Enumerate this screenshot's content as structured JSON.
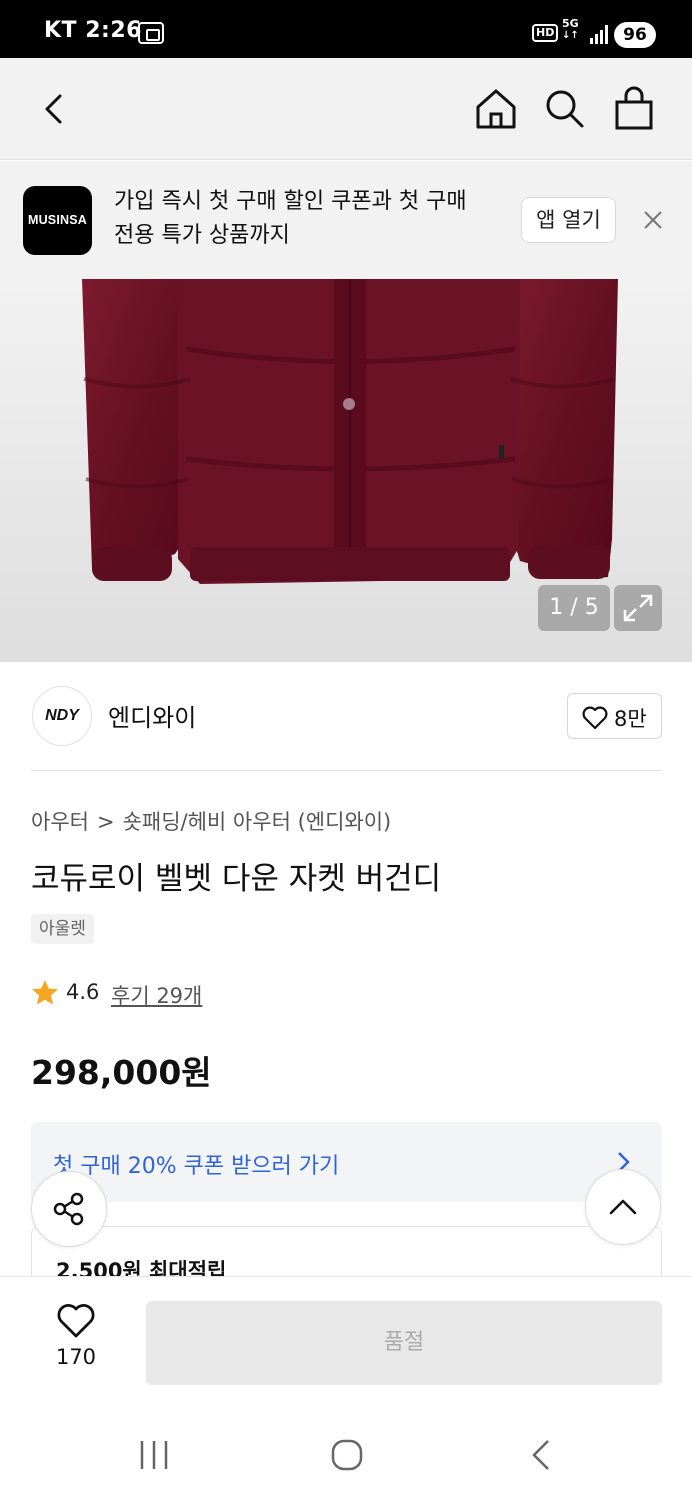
{
  "status_bar": {
    "carrier_time": "KT 2:26",
    "hd": "HD",
    "network": "5G",
    "battery": "96"
  },
  "banner": {
    "logo_text": "MUSINSA",
    "line1": "가입 즉시 첫 구매 할인 쿠폰과 첫 구매",
    "line2": "전용 특가 상품까지",
    "open_app_label": "앱 열기"
  },
  "gallery": {
    "counter": "1 / 5"
  },
  "brand": {
    "logo_text": "NDY",
    "name": "엔디와이",
    "likes": "8만"
  },
  "breadcrumb": {
    "category1": "아우터",
    "separator": ">",
    "category2": "숏패딩/헤비 아우터 (엔디와이)"
  },
  "product": {
    "title": "코듀로이 벨벳 다운 자켓 버건디",
    "tag": "아울렛",
    "rating": "4.6",
    "reviews": "후기 29개",
    "price": "298,000원"
  },
  "coupon": {
    "label": "첫 구매 20% 쿠폰 받으러 가기"
  },
  "points": {
    "label": "2,500원 최대적립"
  },
  "bottom": {
    "wish_count": "170",
    "buy_label": "품절"
  },
  "colors": {
    "accent_blue": "#2f63d9",
    "star": "#f5a623",
    "jacket": "#6e1325"
  }
}
